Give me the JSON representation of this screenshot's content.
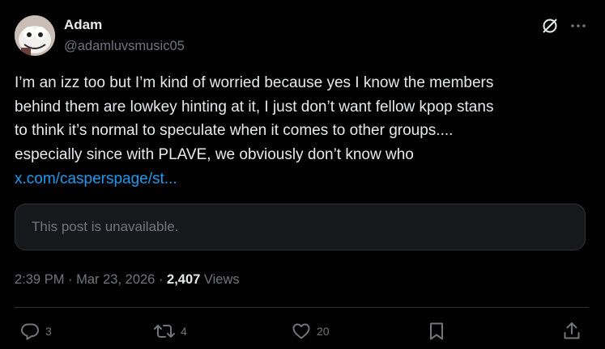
{
  "author": {
    "display_name": "Adam",
    "handle": "@adamluvsmusic05"
  },
  "post": {
    "text": "I’m an izz too but I’m kind of worried because yes I know the members\nbehind them are lowkey hinting at it, I just don’t want fellow kpop stans\nto think it’s normal to speculate when it comes to other groups....\nespecially since with PLAVE, we obviously don’t know who",
    "link_text": "x.com/casperspage/st...",
    "quoted_unavailable_text": "This post is unavailable."
  },
  "meta": {
    "time": "2:39 PM",
    "separator1": " · ",
    "date": "Mar 23, 2026",
    "separator2": " · ",
    "views_count": "2,407",
    "views_label": " Views"
  },
  "actions": {
    "reply_count": "3",
    "repost_count": "4",
    "like_count": "20"
  },
  "icons": {
    "grok": "grok-icon",
    "more": "more-icon",
    "reply": "reply-icon",
    "repost": "repost-icon",
    "like": "heart-icon",
    "bookmark": "bookmark-icon",
    "share": "share-icon"
  },
  "colors": {
    "background": "#000000",
    "text": "#e7e9ea",
    "secondary": "#71767b",
    "link": "#1d9bf0",
    "border": "#2f3336",
    "card_bg": "#16181c"
  }
}
